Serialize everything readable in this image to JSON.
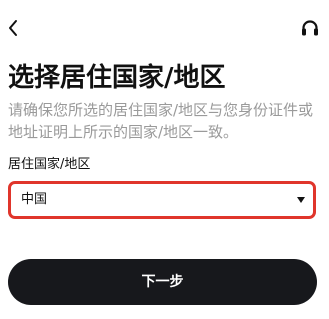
{
  "header": {
    "back_icon": "chevron-left-icon",
    "support_icon": "headset-icon"
  },
  "page": {
    "title": "选择居住国家/地区",
    "description": "请确保您所选的居住国家/地区与您身份证件或地址证明上所示的国家/地区一致。"
  },
  "country_field": {
    "label": "居住国家/地区",
    "value": "中国",
    "dropdown_icon": "caret-down-icon",
    "accent_color": "#e0352b"
  },
  "actions": {
    "next_label": "下一步",
    "next_color": "#17181c"
  }
}
